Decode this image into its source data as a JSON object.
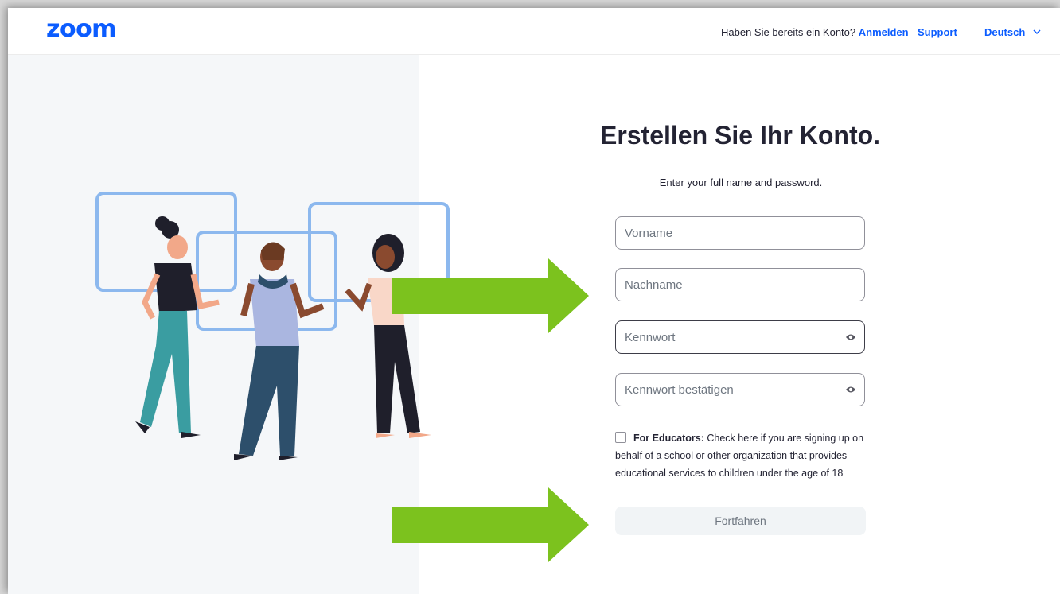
{
  "header": {
    "logo": "zoom",
    "account_prompt": "Haben Sie bereits ein Konto?",
    "signin_link": "Anmelden",
    "support_link": "Support",
    "language": "Deutsch",
    "language_icon": "chevron-down-icon"
  },
  "form": {
    "title": "Erstellen Sie Ihr Konto.",
    "subtitle": "Enter your full name and password.",
    "first_name_placeholder": "Vorname",
    "last_name_placeholder": "Nachname",
    "password_placeholder": "Kennwort",
    "confirm_password_placeholder": "Kennwort bestätigen",
    "password_toggle_icon": "eye-icon",
    "educators_bold": "For Educators:",
    "educators_text": " Check here if you are signing up on behalf of a school or other organization that provides educational services to children under the age of 18",
    "continue_button": "Fortfahren"
  },
  "colors": {
    "brand": "#0b5cff",
    "annotation_arrow": "#7cc21e",
    "left_pane": "#f5f7f9"
  },
  "annotations": {
    "arrow_icon": "right-arrow-icon"
  }
}
